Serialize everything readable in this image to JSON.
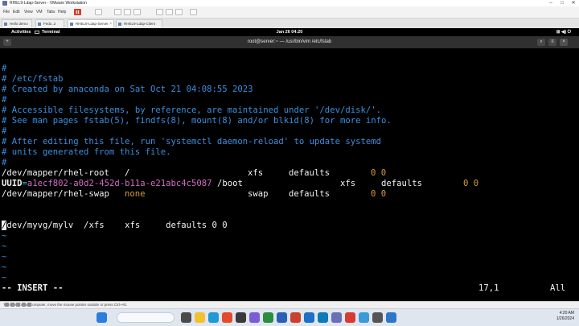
{
  "vmware": {
    "window_title": "RHEL9-Ldap-Server - VMware Workstation",
    "menu": [
      "File",
      "Edit",
      "View",
      "VM",
      "Tabs",
      "Help"
    ],
    "tabs": [
      {
        "label": "Hello demo"
      },
      {
        "label": "Fedo..2"
      },
      {
        "label": "RHEL9-Ldap-Server"
      },
      {
        "label": "RHEL9-Ldap-Client"
      }
    ],
    "hint": "To return to your computer, move the mouse pointer outside or press Ctrl+Alt."
  },
  "gnome": {
    "activities": "Activities",
    "app": "Terminal",
    "clock": "Jan 26 04:20"
  },
  "terminal": {
    "title": "root@server:~ — /usr/bin/vim /etc/fstab",
    "lines": {
      "l1": "#",
      "l2": "# /etc/fstab",
      "l3": "# Created by anaconda on Sat Oct 21 04:08:55 2023",
      "l4": "#",
      "l5": "# Accessible filesystems, by reference, are maintained under '/dev/disk/'.",
      "l6": "# See man pages fstab(5), findfs(8), mount(8) and/or blkid(8) for more info.",
      "l7": "#",
      "l8": "# After editing this file, run 'systemctl daemon-reload' to update systemd",
      "l9": "# units generated from this file.",
      "l10": "#"
    },
    "entries": {
      "root_dev": "/dev/mapper/rhel-root",
      "root_mp": "/",
      "root_fs": "xfs",
      "root_opts": "defaults",
      "root_nums": "0 0",
      "uuid_key": "UUID",
      "uuid_eq": "=",
      "uuid_val": "a1ecf802-a0d2-452d-b11a-e21abc4c5087",
      "boot_mp": "/boot",
      "boot_fs": "xfs",
      "boot_opts": "defaults",
      "boot_nums": "0 0",
      "swap_dev": "/dev/mapper/rhel-swap",
      "swap_mp": "none",
      "swap_fs": "swap",
      "swap_opts": "defaults",
      "swap_nums": "0 0",
      "mylv_cursor": "/",
      "mylv_rest": "dev/myvg/mylv  /xfs    xfs     defaults 0 0"
    },
    "tilde": "~",
    "mode": "-- INSERT --",
    "position": "17,1",
    "scroll": "All"
  },
  "taskbar": {
    "time": "4:20 AM",
    "date": "1/26/2024"
  }
}
